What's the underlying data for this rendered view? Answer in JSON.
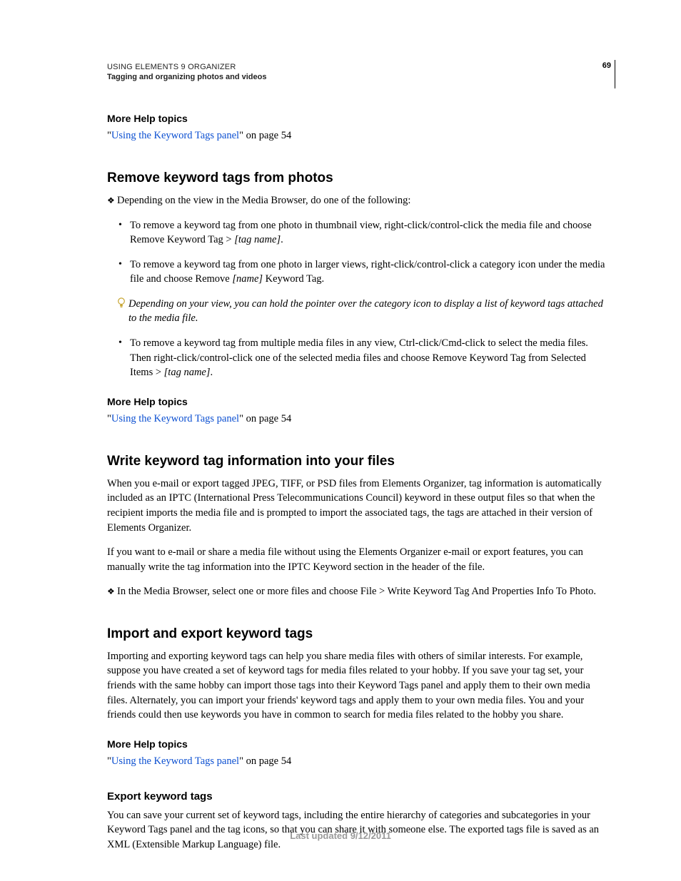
{
  "header": {
    "title": "USING ELEMENTS 9 ORGANIZER",
    "subtitle": "Tagging and organizing photos and videos",
    "page_num": "69"
  },
  "help1": {
    "heading": "More Help topics",
    "link_text": "Using the Keyword Tags panel",
    "suffix": "\" on page 54",
    "prefix": "\""
  },
  "sec1": {
    "heading": "Remove keyword tags from photos",
    "intro": "Depending on the view in the Media Browser, do one of the following:",
    "b1a": "To remove a keyword tag from one photo in thumbnail view, right-click/control-click the media file and choose Remove Keyword Tag > ",
    "b1b": "[tag name]",
    "b1c": ".",
    "b2a": "To remove a keyword tag from one photo in larger views, right-click/control-click a category icon under the media file and choose Remove ",
    "b2b": "[name]",
    "b2c": " Keyword Tag.",
    "tip": "Depending on your view, you can hold the pointer over the category icon to display a list of keyword tags attached to the media file.",
    "b3a": "To remove a keyword tag from multiple media files in any view, Ctrl-click/Cmd-click to select the media files. Then right-click/control-click one of the selected media files and choose Remove Keyword Tag from Selected Items > ",
    "b3b": "[tag name]",
    "b3c": "."
  },
  "help2": {
    "heading": "More Help topics",
    "link_text": "Using the Keyword Tags panel",
    "suffix": "\" on page 54",
    "prefix": "\""
  },
  "sec2": {
    "heading": "Write keyword tag information into your files",
    "p1": "When you e-mail or export tagged JPEG, TIFF, or PSD files from Elements Organizer, tag information is automatically included as an IPTC (International Press Telecommunications Council) keyword in these output files so that when the recipient imports the media file and is prompted to import the associated tags, the tags are attached in their version of Elements Organizer.",
    "p2": "If you want to e-mail or share a media file without using the Elements Organizer e-mail or export features, you can manually write the tag information into the IPTC Keyword section in the header of the file.",
    "step": "In the Media Browser, select one or more files and choose File > Write Keyword Tag And Properties Info To Photo."
  },
  "sec3": {
    "heading": "Import and export keyword tags",
    "p1": "Importing and exporting keyword tags can help you share media files with others of similar interests. For example, suppose you have created a set of keyword tags for media files related to your hobby. If you save your tag set, your friends with the same hobby can import those tags into their Keyword Tags panel and apply them to their own media files. Alternately, you can import your friends' keyword tags and apply them to your own media files. You and your friends could then use keywords you have in common to search for media files related to the hobby you share."
  },
  "help3": {
    "heading": "More Help topics",
    "link_text": "Using the Keyword Tags panel",
    "suffix": "\" on page 54",
    "prefix": "\""
  },
  "sec4": {
    "heading": "Export keyword tags",
    "p1": "You can save your current set of keyword tags, including the entire hierarchy of categories and subcategories in your Keyword Tags panel and the tag icons, so that you can share it with someone else. The exported tags file is saved as an XML (Extensible Markup Language) file."
  },
  "footer": "Last updated 9/12/2011"
}
